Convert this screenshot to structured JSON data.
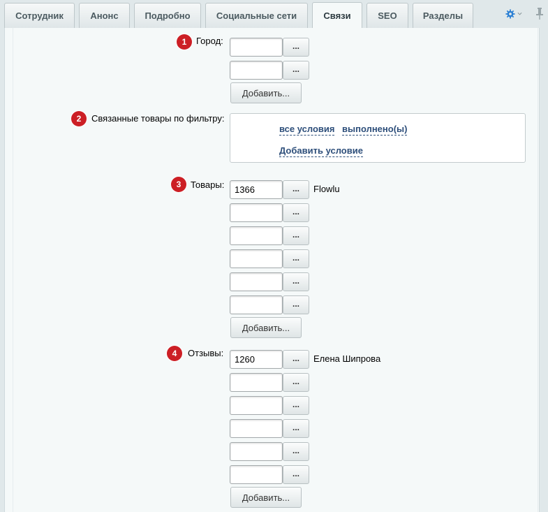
{
  "tabs": [
    {
      "label": "Сотрудник",
      "active": false
    },
    {
      "label": "Анонс",
      "active": false
    },
    {
      "label": "Подробно",
      "active": false
    },
    {
      "label": "Социальные сети",
      "active": false
    },
    {
      "label": "Связи",
      "active": true
    },
    {
      "label": "SEO",
      "active": false
    },
    {
      "label": "Разделы",
      "active": false
    }
  ],
  "fields": {
    "city": {
      "badge": "1",
      "label": "Город:",
      "rows": [
        "",
        ""
      ],
      "browse_label": "...",
      "add_label": "Добавить..."
    },
    "filter": {
      "badge": "2",
      "label": "Связанные товары по фильтру:",
      "condition_all": "все условия",
      "condition_done": "выполнено(ы)",
      "add_condition": "Добавить условие"
    },
    "products": {
      "badge": "3",
      "label": "Товары:",
      "rows": [
        "1366",
        "",
        "",
        "",
        "",
        ""
      ],
      "first_name": "Flowlu",
      "browse_label": "...",
      "add_label": "Добавить..."
    },
    "reviews": {
      "badge": "4",
      "label": "Отзывы:",
      "rows": [
        "1260",
        "",
        "",
        "",
        "",
        ""
      ],
      "first_name": "Елена Шипрова",
      "browse_label": "...",
      "add_label": "Добавить..."
    }
  },
  "colors": {
    "badge": "#cc1f25",
    "link": "#2d4e7a",
    "settings_icon": "#2a7fd4"
  },
  "icons": {
    "settings": "gear-icon",
    "pin": "pin-icon"
  }
}
